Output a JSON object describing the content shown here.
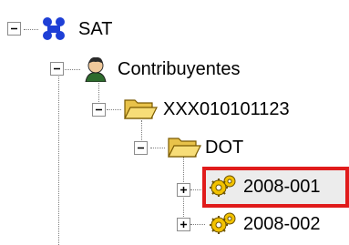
{
  "tree": {
    "root": {
      "label": "SAT",
      "icon": "sat-logo-icon",
      "expanded": true
    },
    "contribuyentes": {
      "label": "Contribuyentes",
      "icon": "person-icon",
      "expanded": true
    },
    "rfc": {
      "label": "XXX010101123",
      "icon": "open-folder-icon",
      "expanded": true
    },
    "dot": {
      "label": "DOT",
      "icon": "open-folder-icon",
      "expanded": true
    },
    "items": [
      {
        "label": "2008-001",
        "icon": "gear-icon",
        "expanded": false,
        "selected": true
      },
      {
        "label": "2008-002",
        "icon": "gear-icon",
        "expanded": false,
        "selected": false
      }
    ]
  },
  "colors": {
    "selection_border": "#e01b1b",
    "folder": "#f4d35e",
    "gear": "#f2c200"
  }
}
